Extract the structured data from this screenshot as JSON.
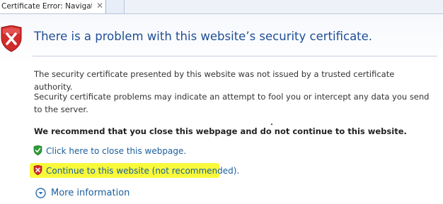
{
  "tab": {
    "title": "Certificate Error: Navigatio...",
    "close": "✕"
  },
  "page": {
    "heading": "There is a problem with this website’s security certificate.",
    "para1": "The security certificate presented by this website was not issued by a trusted certificate authority.",
    "para2": "Security certificate problems may indicate an attempt to fool you or intercept any data you send to the server.",
    "recommend": "We recommend that you close this webpage and do not continue to this website.",
    "close_link": "Click here to close this webpage.",
    "continue_link": "Continue to this website (not recommended).",
    "more_info": "More information"
  },
  "colors": {
    "heading": "#1f4e96",
    "link": "#1a5e9e",
    "highlight": "#f8f93b",
    "error_red": "#d22b2b",
    "ok_green": "#2e9a3a"
  },
  "icons": {
    "error_shield": "shield-x-icon",
    "green_shield": "shield-check-icon",
    "red_shield": "shield-x-small-icon",
    "expand": "chevron-down-circle-icon"
  }
}
